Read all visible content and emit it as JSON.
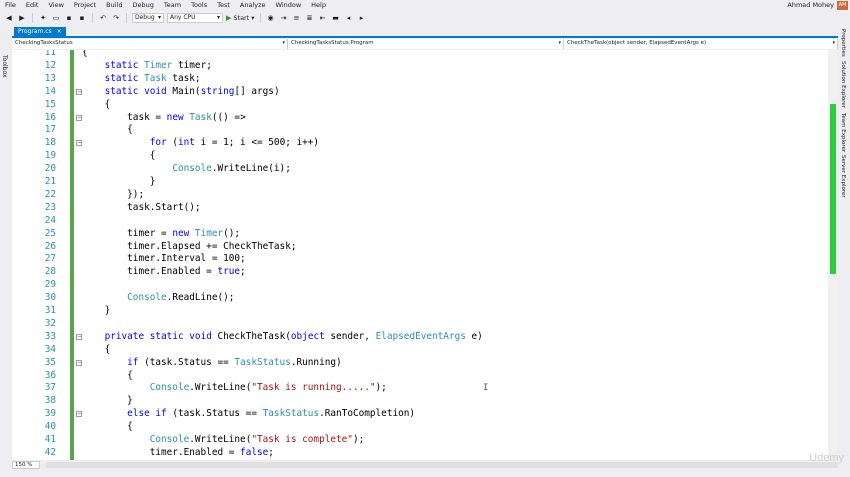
{
  "menu": [
    "File",
    "Edit",
    "View",
    "Project",
    "Build",
    "Debug",
    "Team",
    "Tools",
    "Test",
    "Analyze",
    "Window",
    "Help"
  ],
  "user": {
    "name": "Ahmad Mohey",
    "initials": "AM"
  },
  "toolbar": {
    "config": "Debug",
    "platform": "Any CPU",
    "start": "Start"
  },
  "left_panel": "Toolbox",
  "tab": {
    "label": "Program.cs",
    "close": "×"
  },
  "nav": {
    "project": "CheckingTasksStatus",
    "class": "CheckingTasksStatus.Program",
    "member": "CheckTheTask(object sender, ElapsedEventArgs e)"
  },
  "right_panels": [
    "Properties",
    "Solution Explorer",
    "Team Explorer",
    "Server Explorer"
  ],
  "zoom": "150 %",
  "brand": "Udemy",
  "colors": {
    "accent": "#007acc",
    "keyword": "#0000ff",
    "type": "#2b91af",
    "string": "#a31515",
    "changed": "#57a64a"
  },
  "code_lines": [
    {
      "n": "11",
      "t": "{"
    },
    {
      "n": "12",
      "t": "    static Timer timer;"
    },
    {
      "n": "13",
      "t": "    static Task task;"
    },
    {
      "n": "14",
      "t": "    static void Main(string[] args)"
    },
    {
      "n": "15",
      "t": "    {"
    },
    {
      "n": "16",
      "t": "        task = new Task(() =>"
    },
    {
      "n": "17",
      "t": "        {"
    },
    {
      "n": "18",
      "t": "            for (int i = 1; i <= 500; i++)"
    },
    {
      "n": "19",
      "t": "            {"
    },
    {
      "n": "20",
      "t": "                Console.WriteLine(i);"
    },
    {
      "n": "21",
      "t": "            }"
    },
    {
      "n": "22",
      "t": "        });"
    },
    {
      "n": "23",
      "t": "        task.Start();"
    },
    {
      "n": "24",
      "t": ""
    },
    {
      "n": "25",
      "t": "        timer = new Timer();"
    },
    {
      "n": "26",
      "t": "        timer.Elapsed += CheckTheTask;"
    },
    {
      "n": "27",
      "t": "        timer.Interval = 100;"
    },
    {
      "n": "28",
      "t": "        timer.Enabled = true;"
    },
    {
      "n": "29",
      "t": ""
    },
    {
      "n": "30",
      "t": "        Console.ReadLine();"
    },
    {
      "n": "31",
      "t": "    }"
    },
    {
      "n": "32",
      "t": ""
    },
    {
      "n": "33",
      "t": "    private static void CheckTheTask(object sender, ElapsedEventArgs e)"
    },
    {
      "n": "34",
      "t": "    {"
    },
    {
      "n": "35",
      "t": "        if (task.Status == TaskStatus.Running)"
    },
    {
      "n": "36",
      "t": "        {"
    },
    {
      "n": "37",
      "t": "            Console.WriteLine(\"Task is running.....\");"
    },
    {
      "n": "38",
      "t": "        }"
    },
    {
      "n": "39",
      "t": "        else if (task.Status == TaskStatus.RanToCompletion)"
    },
    {
      "n": "40",
      "t": "        {"
    },
    {
      "n": "41",
      "t": "            Console.WriteLine(\"Task is complete\");"
    },
    {
      "n": "42",
      "t": "            timer.Enabled = false;"
    }
  ]
}
